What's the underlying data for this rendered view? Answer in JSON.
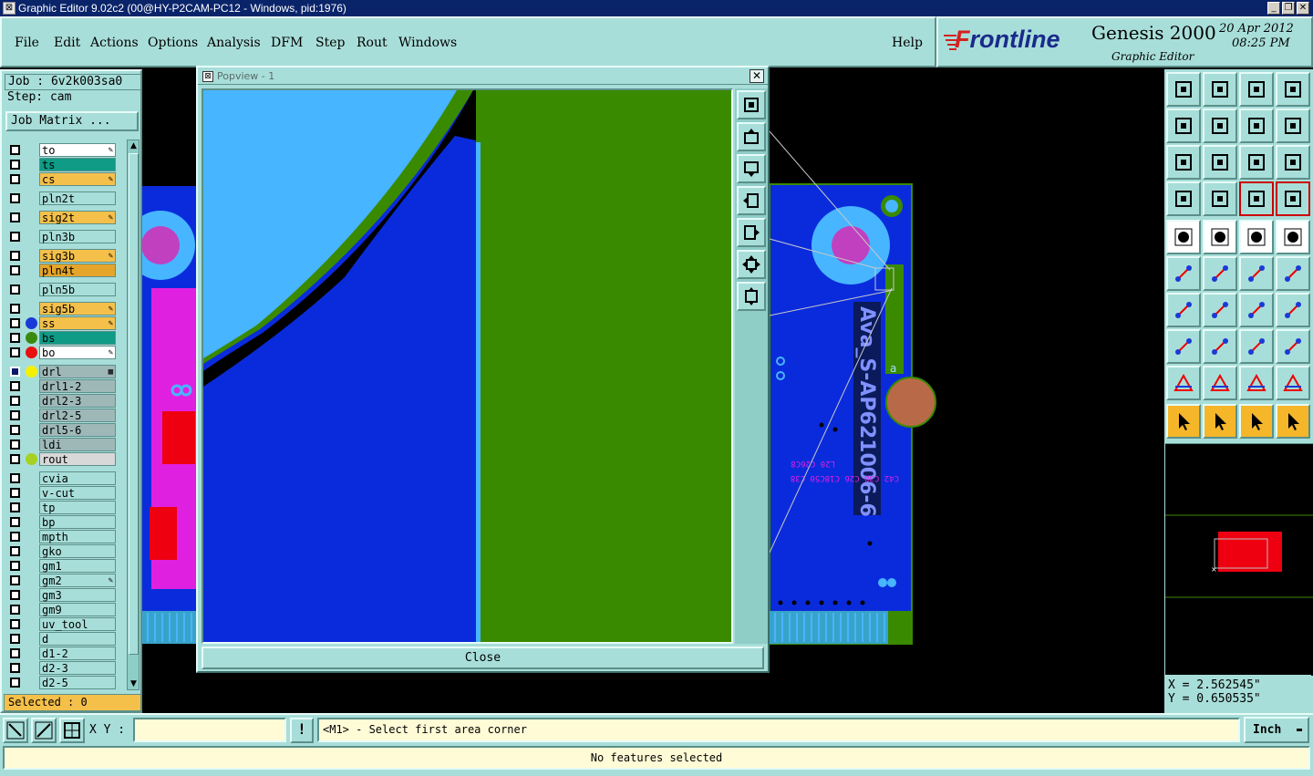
{
  "window": {
    "title": "Graphic Editor 9.02c2 (00@HY-P2CAM-PC12 - Windows, pid:1976)",
    "minimize": "_",
    "restore": "❐",
    "close": "✕"
  },
  "menu": {
    "items": [
      "File",
      "Edit",
      "Actions",
      "Options",
      "Analysis",
      "DFM",
      "Step",
      "Rout",
      "Windows"
    ],
    "help": "Help"
  },
  "brand": {
    "logo_prefix": "F",
    "logo_rest": "rontline",
    "product": "Genesis 2000",
    "subtitle": "Graphic Editor",
    "date": "20 Apr 2012",
    "time": "08:25 PM"
  },
  "job": {
    "job_label": "Job : 6v2k003sa0",
    "step_label": "Step: cam",
    "matrix_button": "Job Matrix ..."
  },
  "layers": [
    {
      "name": "to",
      "bg": "#ffffff",
      "mark": "✎"
    },
    {
      "name": "ts",
      "bg": "#0f9b86",
      "mark": ""
    },
    {
      "name": "cs",
      "bg": "#f5c04a",
      "mark": "✎"
    },
    {
      "name": "pln2t",
      "bg": "#a8ded9",
      "mark": ""
    },
    {
      "name": "sig2t",
      "bg": "#f5c04a",
      "mark": "✎"
    },
    {
      "name": "pln3b",
      "bg": "#a8ded9",
      "mark": ""
    },
    {
      "name": "sig3b",
      "bg": "#f5c04a",
      "mark": "✎"
    },
    {
      "name": "pln4t",
      "bg": "#e5a52a",
      "mark": ""
    },
    {
      "name": "pln5b",
      "bg": "#a8ded9",
      "mark": ""
    },
    {
      "name": "sig5b",
      "bg": "#f5c04a",
      "mark": "✎"
    },
    {
      "name": "ss",
      "bg": "#f5c04a",
      "mark": "✎",
      "dot": "#1a3ad8"
    },
    {
      "name": "bs",
      "bg": "#0f9b86",
      "mark": "",
      "dot": "#3a8a10"
    },
    {
      "name": "bo",
      "bg": "#ffffff",
      "mark": "✎",
      "dot": "#e81010"
    },
    {
      "name": "drl",
      "bg": "#9eb8b8",
      "mark": "▦",
      "dot": "#f5f000",
      "on": true
    },
    {
      "name": "drl1-2",
      "bg": "#9eb8b8",
      "mark": ""
    },
    {
      "name": "drl2-3",
      "bg": "#9eb8b8",
      "mark": ""
    },
    {
      "name": "drl2-5",
      "bg": "#9eb8b8",
      "mark": ""
    },
    {
      "name": "drl5-6",
      "bg": "#9eb8b8",
      "mark": ""
    },
    {
      "name": "ldi",
      "bg": "#9eb8b8",
      "mark": ""
    },
    {
      "name": "rout",
      "bg": "#d8d8d8",
      "mark": "",
      "dot": "#a8d020"
    },
    {
      "name": "cvia",
      "bg": "#a8ded9",
      "mark": ""
    },
    {
      "name": "v-cut",
      "bg": "#a8ded9",
      "mark": ""
    },
    {
      "name": "tp",
      "bg": "#a8ded9",
      "mark": ""
    },
    {
      "name": "bp",
      "bg": "#a8ded9",
      "mark": ""
    },
    {
      "name": "mpth",
      "bg": "#a8ded9",
      "mark": ""
    },
    {
      "name": "gko",
      "bg": "#a8ded9",
      "mark": ""
    },
    {
      "name": "gm1",
      "bg": "#a8ded9",
      "mark": ""
    },
    {
      "name": "gm2",
      "bg": "#a8ded9",
      "mark": "✎"
    },
    {
      "name": "gm3",
      "bg": "#a8ded9",
      "mark": ""
    },
    {
      "name": "gm9",
      "bg": "#a8ded9",
      "mark": ""
    },
    {
      "name": "uv_tool",
      "bg": "#a8ded9",
      "mark": ""
    },
    {
      "name": "d",
      "bg": "#a8ded9",
      "mark": ""
    },
    {
      "name": "d1-2",
      "bg": "#a8ded9",
      "mark": ""
    },
    {
      "name": "d2-3",
      "bg": "#a8ded9",
      "mark": ""
    },
    {
      "name": "d2-5",
      "bg": "#a8ded9",
      "mark": ""
    }
  ],
  "selected_label": "Selected : 0",
  "popview": {
    "title": "Popview - 1",
    "close_x": "✕",
    "close_button": "Close"
  },
  "board": {
    "silkscreen_text": "Ava_S-AP621006-6",
    "badge": "a",
    "refdes_1": "C42 C38 C26 C18C50 C38",
    "refdes_2": "L20 C26C8"
  },
  "coords": {
    "x": "X = 2.562545\"",
    "y": "Y = 0.650535\""
  },
  "command": {
    "xy_label": "X Y :",
    "xy_value": "",
    "bang": "!",
    "message": "<M1> - Select first area corner",
    "units": "Inch"
  },
  "status": "No features selected",
  "colors": {
    "panel": "#a8ded9",
    "pcb_blue": "#0a2bdc",
    "copper_green": "#3a8a00",
    "cyan": "#47b5ff",
    "magenta": "#e020e0",
    "orange_tool": "#f5b62a"
  }
}
